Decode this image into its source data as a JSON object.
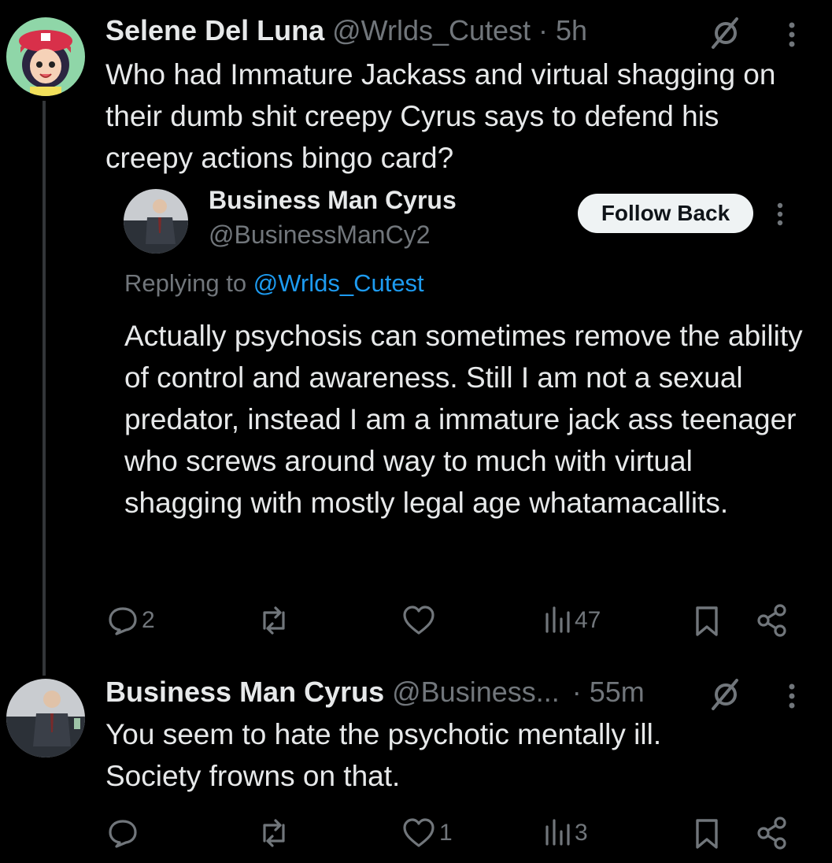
{
  "post1": {
    "display_name": "Selene Del Luna",
    "handle": "@Wrlds_Cutest",
    "time": "· 5h",
    "text": "Who had Immature Jackass and virtual shagging on their dumb shit creepy Cyrus says to defend his creepy actions bingo card?",
    "quoted": {
      "display_name": "Business Man Cyrus",
      "handle": "@BusinessManCy2",
      "follow_label": "Follow Back",
      "replying_prefix": "Replying to",
      "replying_handle": "@Wrlds_Cutest",
      "text": "Actually psychosis can sometimes remove the ability of control and awareness. Still I am not a sexual predator, instead I am a immature jack ass teenager who screws around way to much with virtual shagging with mostly legal age whatamacallits."
    },
    "actions": {
      "replies": "2",
      "reposts": "",
      "likes": "",
      "views": "47"
    }
  },
  "post2": {
    "display_name": "Business Man Cyrus",
    "handle": "@Business...",
    "time": "· 55m",
    "text": "You seem to hate the psychotic mentally ill. Society frowns on that.",
    "actions": {
      "replies": "",
      "reposts": "",
      "likes": "1",
      "views": "3"
    }
  },
  "icons": {
    "grok": "grok-slash-icon",
    "more": "more-vertical-icon",
    "reply": "reply-bubble-icon",
    "repost": "repost-icon",
    "like": "heart-icon",
    "views": "views-bars-icon",
    "bookmark": "bookmark-icon",
    "share": "share-icon"
  },
  "colors": {
    "background": "#000000",
    "text": "#e7e9ea",
    "muted": "#71767b",
    "link": "#1d9bf0",
    "thread_line": "#333639"
  }
}
